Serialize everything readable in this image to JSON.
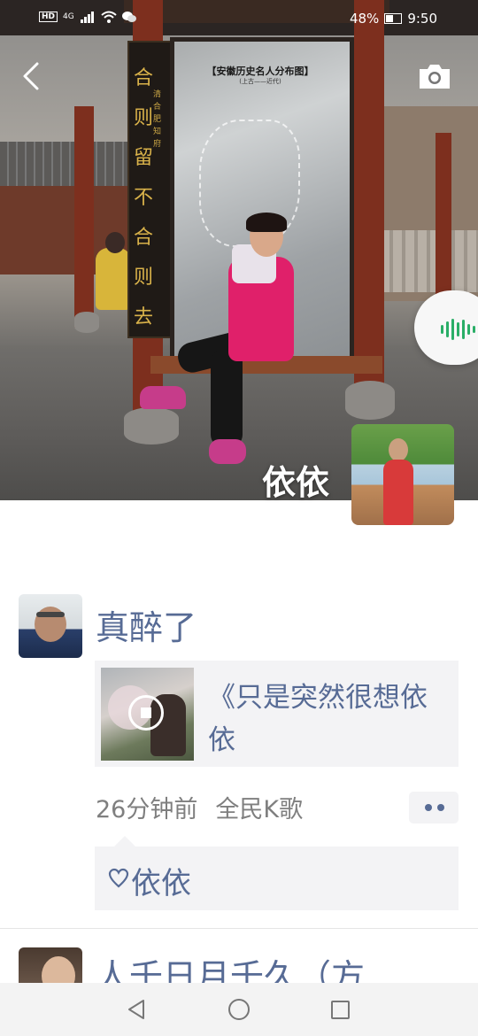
{
  "status_bar": {
    "network": "4G",
    "battery": "48%",
    "time": "9:50"
  },
  "cover": {
    "board_title": "【安徽历史名人分布图】",
    "board_subtitle": "(上古——近代)",
    "couplet_main": "合则留不合则去",
    "couplet_small": "清合肥知府",
    "owner_name": "依依"
  },
  "posts": [
    {
      "poster_name": "真醉了",
      "share_title": "《只是突然很想依依",
      "time_ago": "26分钟前",
      "source": "全民K歌",
      "likes": [
        "依依"
      ]
    },
    {
      "poster_name": "人千日月千久（方"
    }
  ],
  "icons": {
    "back": "chevron-left-icon",
    "camera": "camera-icon",
    "voice": "voice-wave-icon",
    "play": "stop-icon",
    "like": "heart-icon",
    "more": "more-dots-icon"
  },
  "colors": {
    "link_blue": "#576b95",
    "voice_green": "#2aae67",
    "card_bg": "#f3f3f5"
  }
}
